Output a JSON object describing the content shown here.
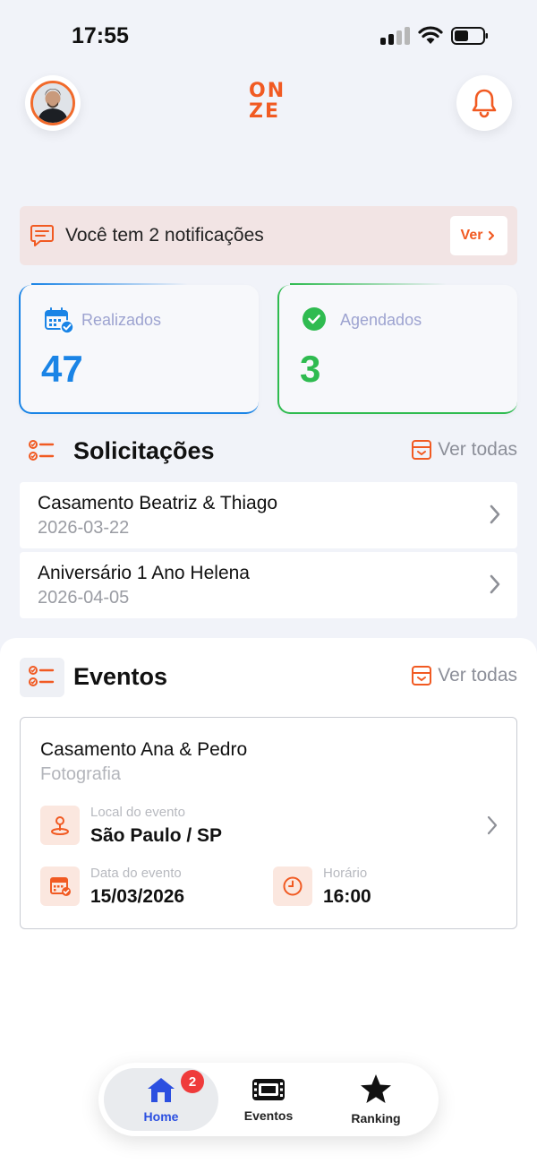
{
  "status_bar": {
    "time": "17:55"
  },
  "header": {
    "logo_top": [
      "O",
      "N"
    ],
    "logo_bottom": [
      "Z",
      "E"
    ]
  },
  "notification": {
    "text": "Você tem 2 notificações",
    "button_label": "Ver"
  },
  "stats": [
    {
      "label": "Realizados",
      "value": "47",
      "color": "#1a84e6"
    },
    {
      "label": "Agendados",
      "value": "3",
      "color": "#2fbb50"
    }
  ],
  "requests": {
    "title": "Solicitações",
    "see_all": "Ver todas",
    "items": [
      {
        "title": "Casamento Beatriz & Thiago",
        "date": "2026-03-22"
      },
      {
        "title": "Aniversário 1 Ano Helena",
        "date": "2026-04-05"
      }
    ]
  },
  "events": {
    "title": "Eventos",
    "see_all": "Ver todas",
    "card": {
      "title": "Casamento Ana & Pedro",
      "subtitle": "Fotografia",
      "location_label": "Local do evento",
      "location_value": "São Paulo / SP",
      "date_label": "Data do evento",
      "date_value": "15/03/2026",
      "time_label": "Horário",
      "time_value": "16:00"
    }
  },
  "bottom_nav": {
    "items": [
      {
        "label": "Home",
        "icon": "home-icon",
        "badge": "2",
        "active": true
      },
      {
        "label": "Eventos",
        "icon": "ticket-icon"
      },
      {
        "label": "Ranking",
        "icon": "star-icon"
      }
    ]
  },
  "colors": {
    "accent": "#f15a22",
    "blue": "#1a84e6",
    "green": "#2fbb50",
    "nav_active": "#2b4fe0",
    "badge": "#ef3b3b"
  }
}
